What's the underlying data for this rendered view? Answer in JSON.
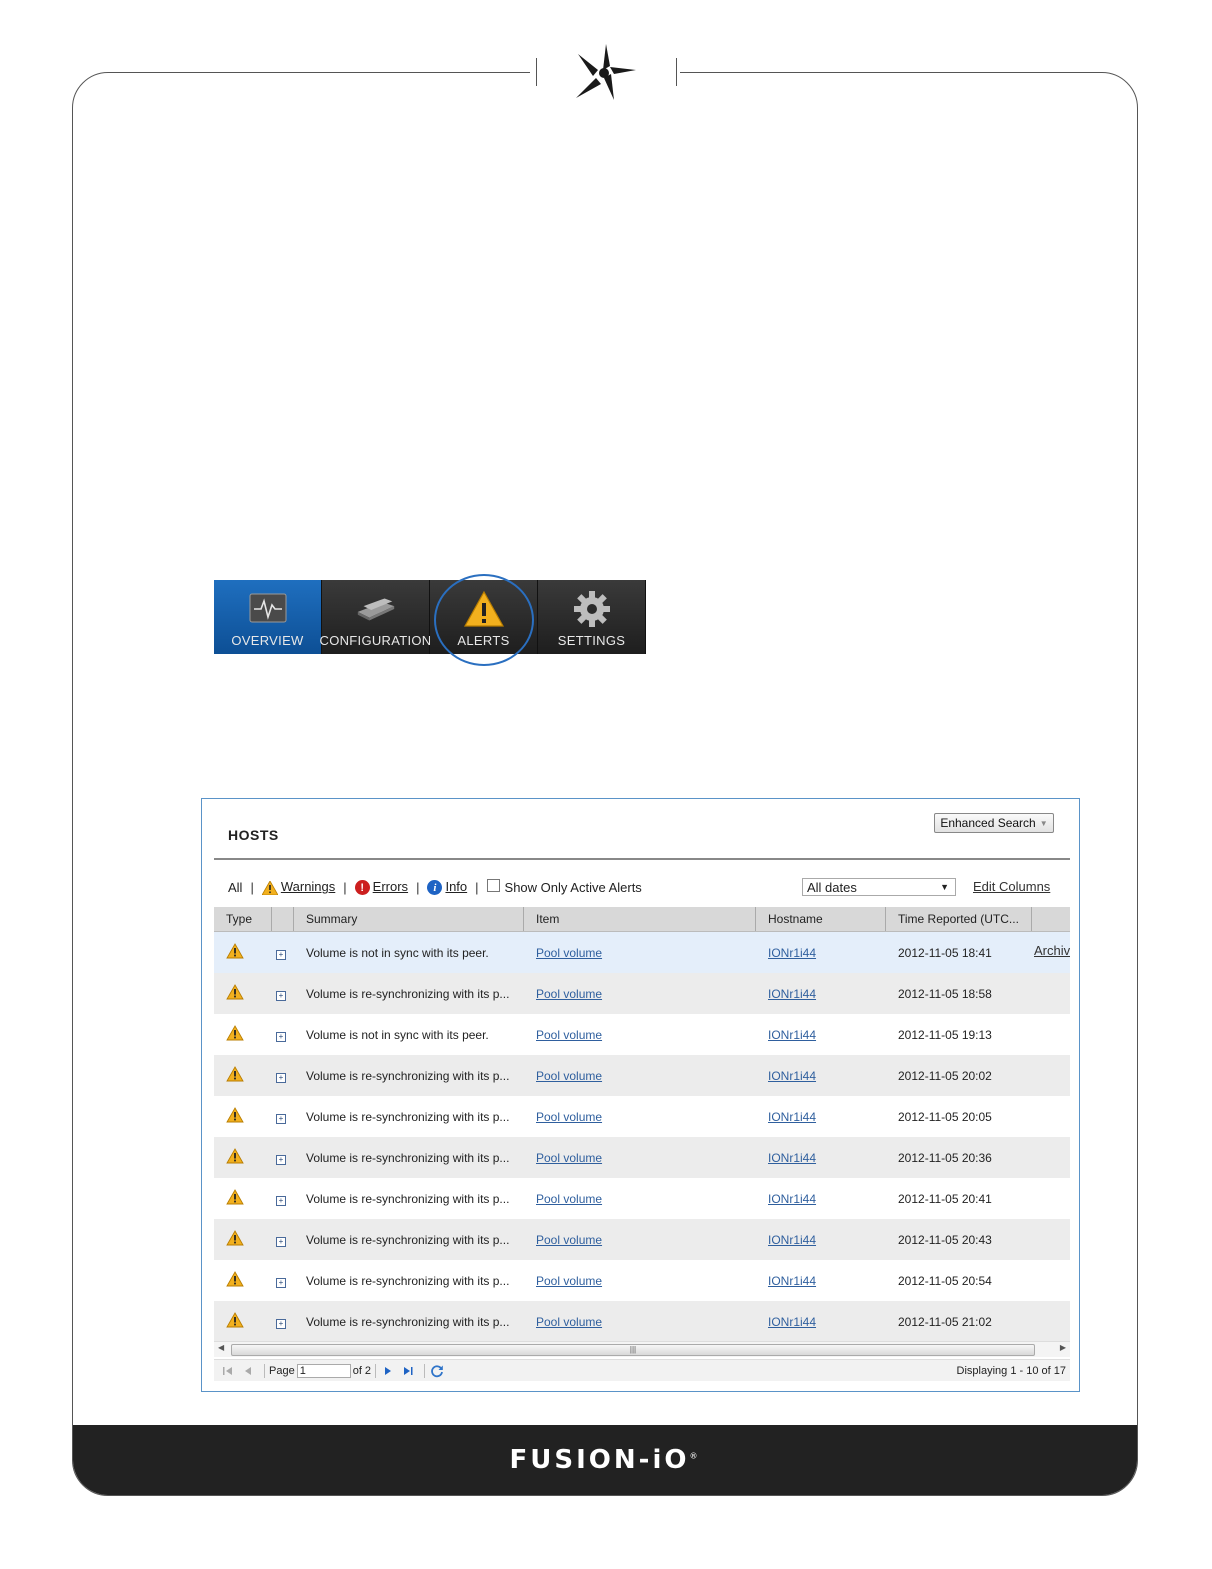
{
  "nav": {
    "tabs": [
      {
        "label": "OVERVIEW",
        "icon": "activity-monitor-icon",
        "active": true
      },
      {
        "label": "CONFIGURATION",
        "icon": "memory-card-icon",
        "active": false
      },
      {
        "label": "ALERTS",
        "icon": "warning-icon",
        "active": false
      },
      {
        "label": "SETTINGS",
        "icon": "gear-icon",
        "active": false
      }
    ]
  },
  "panel": {
    "title": "HOSTS",
    "enhanced_search_label": "Enhanced Search",
    "filters": {
      "all": "All",
      "warnings": "Warnings",
      "errors": "Errors",
      "info": "Info",
      "active_only": "Show Only Active Alerts"
    },
    "date_filter": "All dates",
    "edit_columns": "Edit Columns",
    "columns": [
      "Type",
      "",
      "Summary",
      "Item",
      "Hostname",
      "Time Reported (UTC..."
    ],
    "archive_label": "Archive",
    "rows": [
      {
        "summary": "Volume is not in sync with its peer.",
        "item": "Pool volume",
        "hostname": "IONr1i44",
        "time": "2012-11-05 18:41"
      },
      {
        "summary": "Volume is re-synchronizing with its p...",
        "item": "Pool volume",
        "hostname": "IONr1i44",
        "time": "2012-11-05 18:58"
      },
      {
        "summary": "Volume is not in sync with its peer.",
        "item": "Pool volume",
        "hostname": "IONr1i44",
        "time": "2012-11-05 19:13"
      },
      {
        "summary": "Volume is re-synchronizing with its p...",
        "item": "Pool volume",
        "hostname": "IONr1i44",
        "time": "2012-11-05 20:02"
      },
      {
        "summary": "Volume is re-synchronizing with its p...",
        "item": "Pool volume",
        "hostname": "IONr1i44",
        "time": "2012-11-05 20:05"
      },
      {
        "summary": "Volume is re-synchronizing with its p...",
        "item": "Pool volume",
        "hostname": "IONr1i44",
        "time": "2012-11-05 20:36"
      },
      {
        "summary": "Volume is re-synchronizing with its p...",
        "item": "Pool volume",
        "hostname": "IONr1i44",
        "time": "2012-11-05 20:41"
      },
      {
        "summary": "Volume is re-synchronizing with its p...",
        "item": "Pool volume",
        "hostname": "IONr1i44",
        "time": "2012-11-05 20:43"
      },
      {
        "summary": "Volume is re-synchronizing with its p...",
        "item": "Pool volume",
        "hostname": "IONr1i44",
        "time": "2012-11-05 20:54"
      },
      {
        "summary": "Volume is re-synchronizing with its p...",
        "item": "Pool volume",
        "hostname": "IONr1i44",
        "time": "2012-11-05 21:02"
      }
    ],
    "pager": {
      "page_label": "Page",
      "page_value": "1",
      "of_label": "of 2",
      "display": "Displaying 1 - 10 of 17"
    }
  },
  "footer": {
    "brand": "FUSION-iO",
    "trademark": "®"
  },
  "colors": {
    "accent": "#1f6fbf",
    "warning": "#f2b01e",
    "error": "#cc1f1f",
    "info": "#1e63c4",
    "link": "#2f5f9e"
  }
}
